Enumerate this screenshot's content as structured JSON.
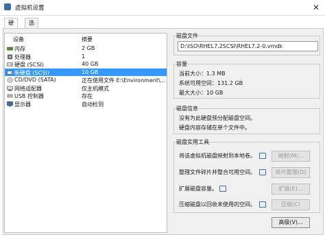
{
  "window": {
    "title": "虚拟机设置",
    "close_glyph": "✕"
  },
  "tabs": [
    {
      "label": "硬件"
    },
    {
      "label": "选项"
    }
  ],
  "device_list": {
    "col_device": "设备",
    "col_summary": "摘要",
    "rows": [
      {
        "name": "内存",
        "summary": "2 GB",
        "icon": "memory-icon"
      },
      {
        "name": "处理器",
        "summary": "1",
        "icon": "processor-icon"
      },
      {
        "name": "硬盘 (SCSI)",
        "summary": "40 GB",
        "icon": "hard-disk-icon"
      },
      {
        "name": "新硬盘 (SCSI)",
        "summary": "10 GB",
        "icon": "hard-disk-icon"
      },
      {
        "name": "CD/DVD (SATA)",
        "summary": "正在使用文件 E:\\Environment\\...",
        "icon": "cd-dvd-icon"
      },
      {
        "name": "网络适配器",
        "summary": "仅主机模式",
        "icon": "network-adapter-icon"
      },
      {
        "name": "USB 控制器",
        "summary": "存在",
        "icon": "usb-icon"
      },
      {
        "name": "显示器",
        "summary": "自动检测",
        "icon": "display-icon"
      }
    ]
  },
  "disk_file": {
    "label": "磁盘文件",
    "value": "D:\\ISO\\RHEL7.2SCSI\\RHEL7.2-0.vmdk"
  },
  "capacity": {
    "label": "容量",
    "current_size": "当前大小：1.3 MB",
    "system_free": "系统可用空间：131.2 GB",
    "max_size": "最大大小：10 GB"
  },
  "disk_info": {
    "label": "磁盘信息",
    "line1": "没有为此硬盘预分配磁盘空间。",
    "line2": "硬盘内容存储在单个文件中。"
  },
  "utilities": {
    "label": "磁盘实用工具",
    "map": {
      "text": "将该虚拟机磁盘映射到本地卷。",
      "button": "映射(M)..."
    },
    "defrag": {
      "text": "整理文件碎片并整合可用空间。",
      "button": "碎片整理(D)"
    },
    "expand": {
      "text": "扩展磁盘容量。",
      "button": "扩展(E)..."
    },
    "compact": {
      "text": "压缩磁盘以回收未使用的空间。",
      "button": "压缩(C)"
    }
  },
  "advanced_button": "高级(V)...",
  "colors": {
    "selection": "#3399ff",
    "accent": "#3a6ea5"
  }
}
